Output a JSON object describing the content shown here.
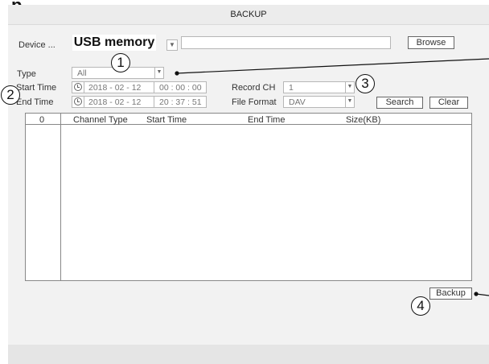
{
  "window": {
    "title": "BACKUP"
  },
  "device": {
    "label": "Device ...",
    "value": "USB memory",
    "path_value": "",
    "browse_label": "Browse"
  },
  "filters": {
    "type_label": "Type",
    "type_value": "All",
    "start_time_label": "Start Time",
    "start_date": "2018 - 02 - 12",
    "start_time": "00 : 00 : 00",
    "end_time_label": "End Time",
    "end_date": "2018 - 02 - 12",
    "end_time": "20 : 37 : 51",
    "record_ch_label": "Record CH",
    "record_ch_value": "1",
    "file_format_label": "File Format",
    "file_format_value": "DAV",
    "search_label": "Search",
    "clear_label": "Clear"
  },
  "table": {
    "columns": [
      "0",
      "Channel Type",
      "Start Time",
      "End Time",
      "Size(KB)"
    ],
    "rows": []
  },
  "backup_label": "Backup",
  "callouts": [
    "1",
    "2",
    "3",
    "4"
  ],
  "icons": {
    "dropdown": "chevron-down-icon",
    "clock": "clock-icon"
  },
  "colors": {
    "background": "#f2f2f2",
    "field": "#ffffff",
    "border": "#b7b7b7"
  }
}
